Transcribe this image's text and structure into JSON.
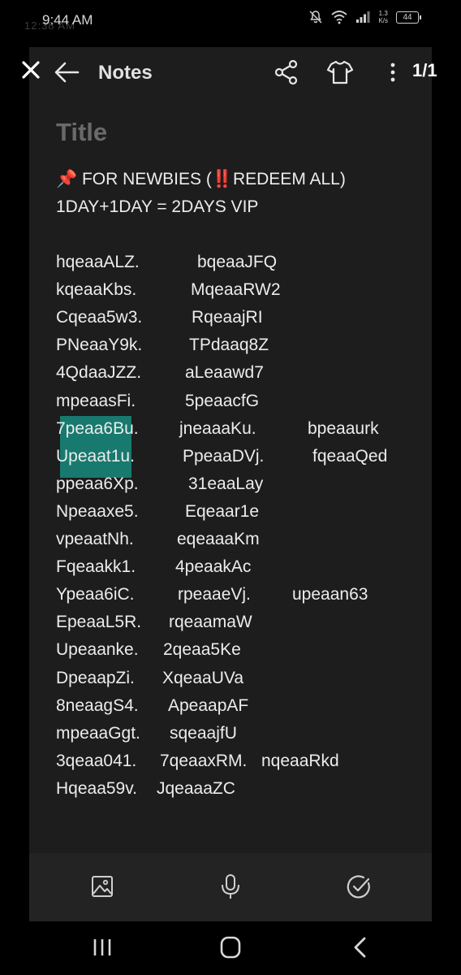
{
  "status_bar": {
    "time": "9:44 AM",
    "speed_top": "1.3",
    "speed_bottom": "K/s",
    "battery": "44",
    "ghost_overlay": "12:38 AM"
  },
  "toolbar": {
    "title": "Notes",
    "page_count": "1/1"
  },
  "note": {
    "title_placeholder": "Title",
    "header_line1": "📌 FOR NEWBIES (‼️REDEEM ALL)",
    "header_line2": "1DAY+1DAY = 2DAYS VIP",
    "rows": [
      [
        "hqeaaALZ.",
        "bqeaaJFQ",
        ""
      ],
      [
        "kqeaaKbs.",
        "MqeaaRW2",
        ""
      ],
      [
        "Cqeaa5w3.",
        "RqeaajRI",
        ""
      ],
      [
        "PNeaaY9k.",
        "TPdaaq8Z",
        ""
      ],
      [
        "4QdaaJZZ.",
        "aLeaawd7",
        ""
      ],
      [
        "mpeaasFi.",
        "5peaacfG",
        ""
      ],
      [
        "7peaa6Bu.",
        "jneaaaKu.",
        "bpeaaurk"
      ],
      [
        "Upeaat1u.",
        "PpeaaDVj.",
        "fqeaaQed"
      ],
      [
        "ppeaa6Xp.",
        "31eaaLay",
        ""
      ],
      [
        "Npeaaxe5.",
        "Eqeaar1e",
        ""
      ],
      [
        "vpeaatNh.",
        "eqeaaaKm",
        ""
      ],
      [
        "Fqeaakk1.",
        "4peaakAc",
        ""
      ],
      [
        "Ypeaa6iC.",
        "rpeaaeVj.",
        "upeaan63"
      ],
      [
        "EpeaaL5R.",
        "rqeaamaW",
        ""
      ],
      [
        "Upeaanke.",
        "2qeaa5Ke",
        ""
      ],
      [
        "DpeaapZi.",
        "XqeaaUVa",
        ""
      ],
      [
        "8neaagS4.",
        "ApeaapAF",
        ""
      ],
      [
        "mpeaaGgt.",
        "sqeaajfU",
        ""
      ],
      [
        "3qeaa041.",
        "7qeaaxRM.",
        "nqeaaRkd"
      ],
      [
        "Hqeaa59v.",
        "JqeaaaZC",
        ""
      ]
    ]
  },
  "icons": {
    "close": "close-icon",
    "back": "arrow-left-icon",
    "share": "share-icon",
    "shirt": "shirt-icon",
    "more": "more-vertical-icon",
    "image": "image-icon",
    "mic": "microphone-icon",
    "check": "check-circle-icon",
    "recents": "recents-icon",
    "home": "home-icon",
    "nav_back": "nav-back-icon"
  },
  "colors": {
    "background": "#000000",
    "panel": "#1d1d1d",
    "selection": "#178a7c"
  }
}
